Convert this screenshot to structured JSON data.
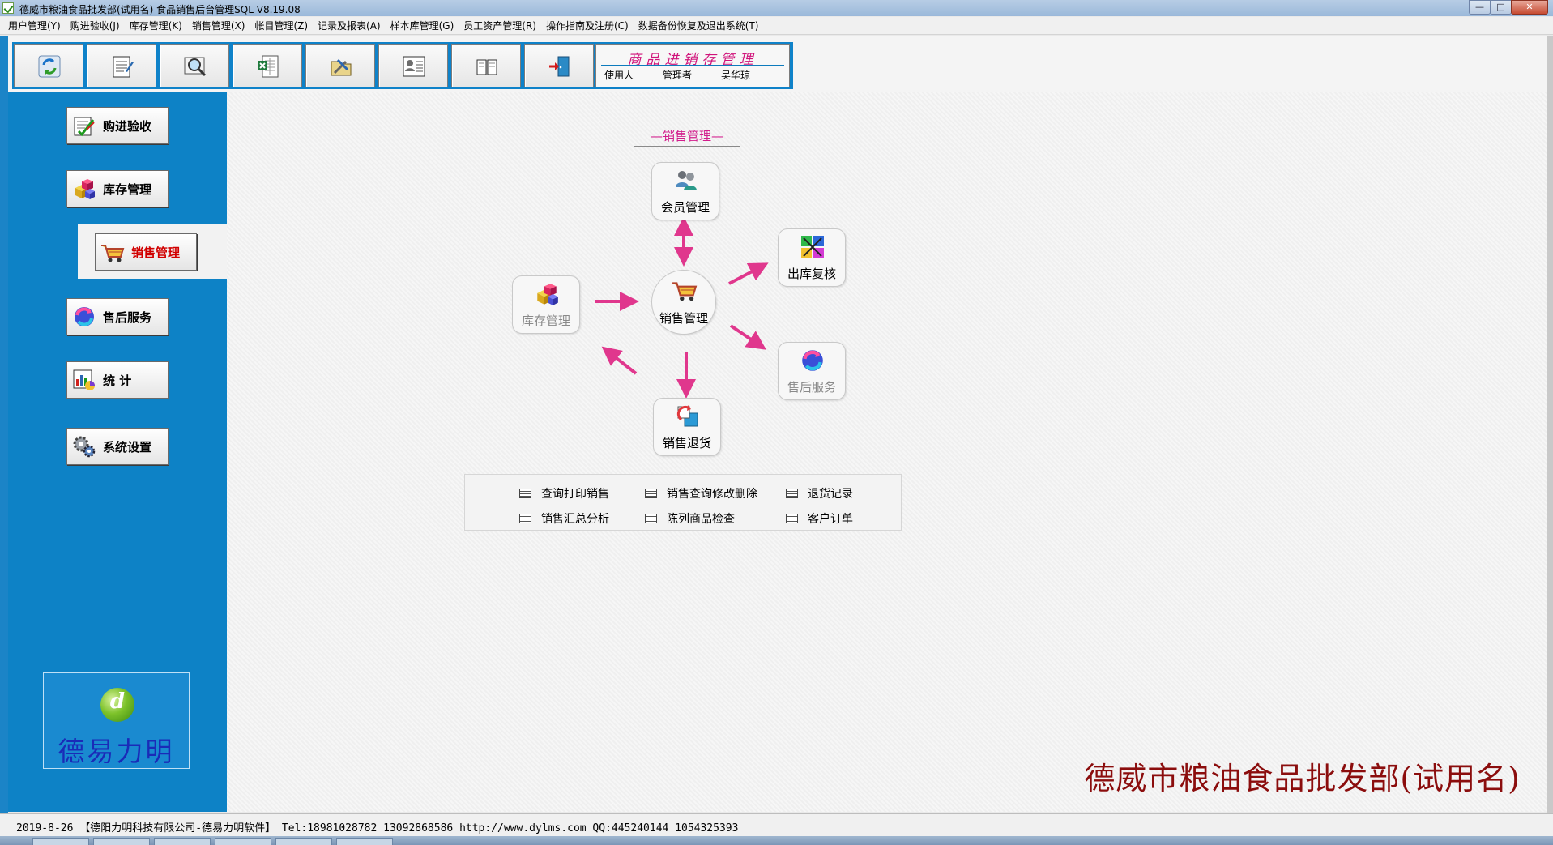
{
  "window": {
    "title": "德威市粮油食品批发部(试用名)  食品销售后台管理SQL V8.19.08",
    "controls": [
      "—",
      "□",
      "✕"
    ]
  },
  "menu": [
    "用户管理(Y)",
    "购进验收(J)",
    "库存管理(K)",
    "销售管理(X)",
    "帐目管理(Z)",
    "记录及报表(A)",
    "样本库管理(G)",
    "员工资产管理(R)",
    "操作指南及注册(C)",
    "数据备份恢复及退出系统(T)"
  ],
  "toolbar": {
    "buttons": [
      {
        "icon": "refresh-icon"
      },
      {
        "icon": "notepad-icon"
      },
      {
        "icon": "magnifier-icon"
      },
      {
        "icon": "spreadsheet-icon"
      },
      {
        "icon": "folder-tools-icon"
      },
      {
        "icon": "contacts-icon"
      },
      {
        "icon": "book-icon"
      },
      {
        "icon": "exit-door-icon"
      }
    ],
    "brand": "商品进销存管理",
    "user_label": "使用人",
    "role": "管理者",
    "user_name": "吴华琼"
  },
  "sidebar": {
    "items": [
      {
        "label": "购进验收",
        "icon": "purchase-check-icon"
      },
      {
        "label": "库存管理",
        "icon": "inventory-boxes-icon"
      },
      {
        "label": "销售管理",
        "icon": "shopping-cart-icon",
        "active": true
      },
      {
        "label": "售后服务",
        "icon": "after-sales-icon"
      },
      {
        "label": "统  计",
        "icon": "statistics-chart-icon"
      },
      {
        "label": "系统设置",
        "icon": "settings-gears-icon"
      }
    ],
    "logo_text": "德易力明",
    "logo_icon": "globe-logo-icon"
  },
  "main": {
    "section_title": "—销售管理—",
    "nodes": {
      "member": {
        "label": "会员管理",
        "icon": "members-icon"
      },
      "outbound": {
        "label": "出库复核",
        "icon": "outbound-review-icon"
      },
      "inventory": {
        "label": "库存管理",
        "icon": "inventory-boxes-icon"
      },
      "sales": {
        "label": "销售管理",
        "icon": "shopping-cart-icon"
      },
      "after_sales": {
        "label": "售后服务",
        "icon": "after-sales-icon"
      },
      "returns": {
        "label": "销售退货",
        "icon": "sales-return-icon"
      }
    },
    "links": [
      "查询打印销售",
      "销售查询修改删除",
      "退货记录",
      "销售汇总分析",
      "陈列商品检查",
      "客户订单"
    ],
    "company": "德威市粮油食品批发部(试用名)"
  },
  "status": {
    "text": "2019-8-26 【德阳力明科技有限公司-德易力明软件】 Tel:18981028782 13092868586 http://www.dylms.com QQ:445240144 1054325393"
  },
  "colors": {
    "sidebar_blue": "#0d82c6",
    "accent_magenta": "#d21d8c",
    "company_red": "#8b0d0d",
    "logo_text": "#1a2bb8"
  }
}
